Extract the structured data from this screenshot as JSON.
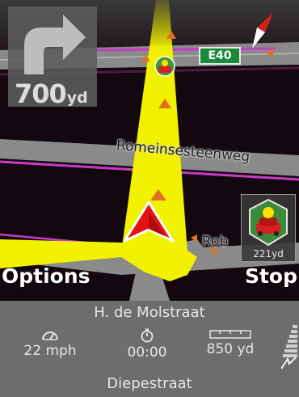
{
  "turn_instruction": {
    "icon": "turn-right-arrow-icon",
    "distance_value": "700",
    "distance_unit": "yd"
  },
  "road_sign": {
    "label": "E40",
    "color": "#1b8a3a"
  },
  "map_labels": {
    "street_1": "Romeinsesteenweg",
    "street_2": "Rob"
  },
  "compass": {
    "icon": "compass-icon"
  },
  "speed_camera": {
    "icon": "speed-camera-icon",
    "distance": "221yd"
  },
  "softkeys": {
    "left": "Options",
    "right": "Stop"
  },
  "info_panel": {
    "next_street": "H. de Molstraat",
    "current_street": "Diepestraat",
    "speed": {
      "icon": "speedometer-icon",
      "value": "22 mph"
    },
    "time": {
      "icon": "stopwatch-icon",
      "value": "00:00"
    },
    "remaining": {
      "icon": "ruler-icon",
      "value": "850 yd"
    },
    "signal_icon": "signal-strength-icon"
  },
  "colors": {
    "route": "#f2f200",
    "map_background": "#120710",
    "road": "#8a8a8a",
    "border_line": "#c63cc6",
    "panel": "#6d6d6d",
    "position_arrow": "#e51212"
  }
}
